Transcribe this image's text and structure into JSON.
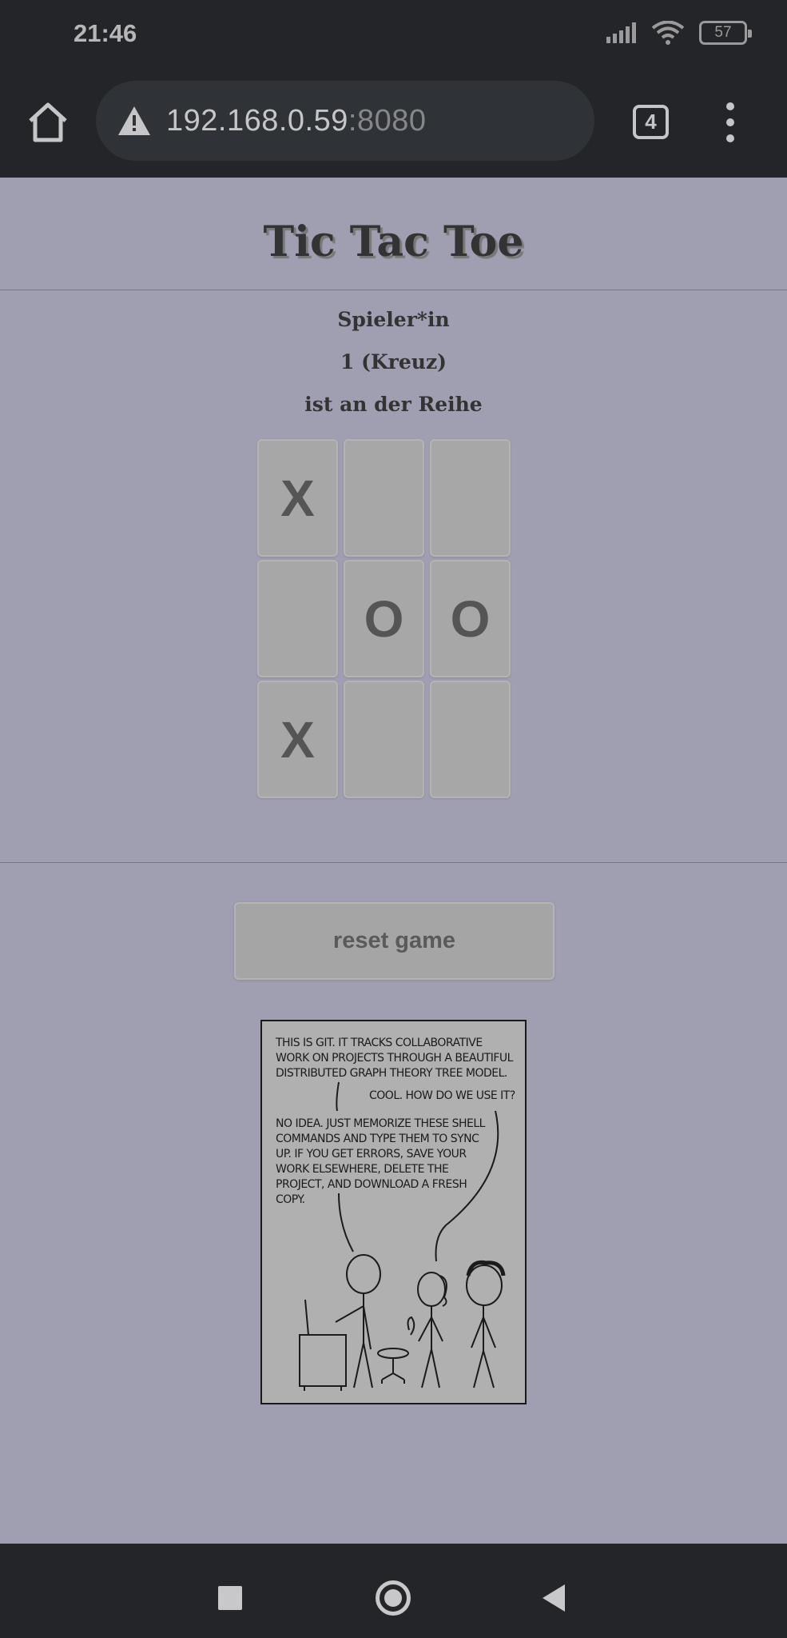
{
  "status_bar": {
    "time": "21:46",
    "battery": "57"
  },
  "browser": {
    "url_host": "192.168.0.59",
    "url_port": ":8080",
    "tab_count": "4"
  },
  "page": {
    "title": "Tic Tac Toe",
    "turn_lines": [
      "Spieler*in",
      "1 (Kreuz)",
      "ist an der Reihe"
    ],
    "board": [
      "X",
      "",
      "",
      "",
      "O",
      "O",
      "X",
      "",
      ""
    ],
    "reset_label": "reset game"
  },
  "comic": {
    "caption_1": "This is GIT. It tracks collaborative work on projects through a beautiful distributed graph theory tree model.",
    "caption_2": "Cool. How do we use it?",
    "caption_3": "No idea. Just memorize these shell commands and type them to sync up. If you get errors, save your work elsewhere, delete the project, and download a fresh copy."
  }
}
